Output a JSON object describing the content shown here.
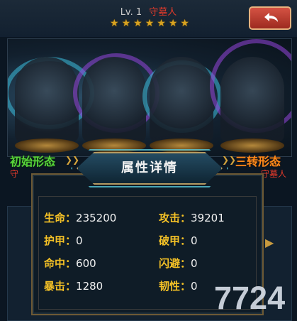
{
  "header": {
    "level": "Lv. 1",
    "hero_name": "守墓人",
    "stars": 7,
    "back_icon": "return-arrow-icon"
  },
  "forms": {
    "left_label": "初始形态",
    "right_label": "三转形态",
    "left_sub": "守",
    "right_sub": "守墓人"
  },
  "panel": {
    "title": "属性详情",
    "stats": [
      {
        "label": "生命",
        "value": "235200"
      },
      {
        "label": "攻击",
        "value": "39201"
      },
      {
        "label": "护甲",
        "value": "0"
      },
      {
        "label": "破甲",
        "value": "0"
      },
      {
        "label": "命中",
        "value": "600"
      },
      {
        "label": "闪避",
        "value": "0"
      },
      {
        "label": "暴击",
        "value": "1280"
      },
      {
        "label": "韧性",
        "value": "0"
      }
    ]
  },
  "watermark": "7724"
}
